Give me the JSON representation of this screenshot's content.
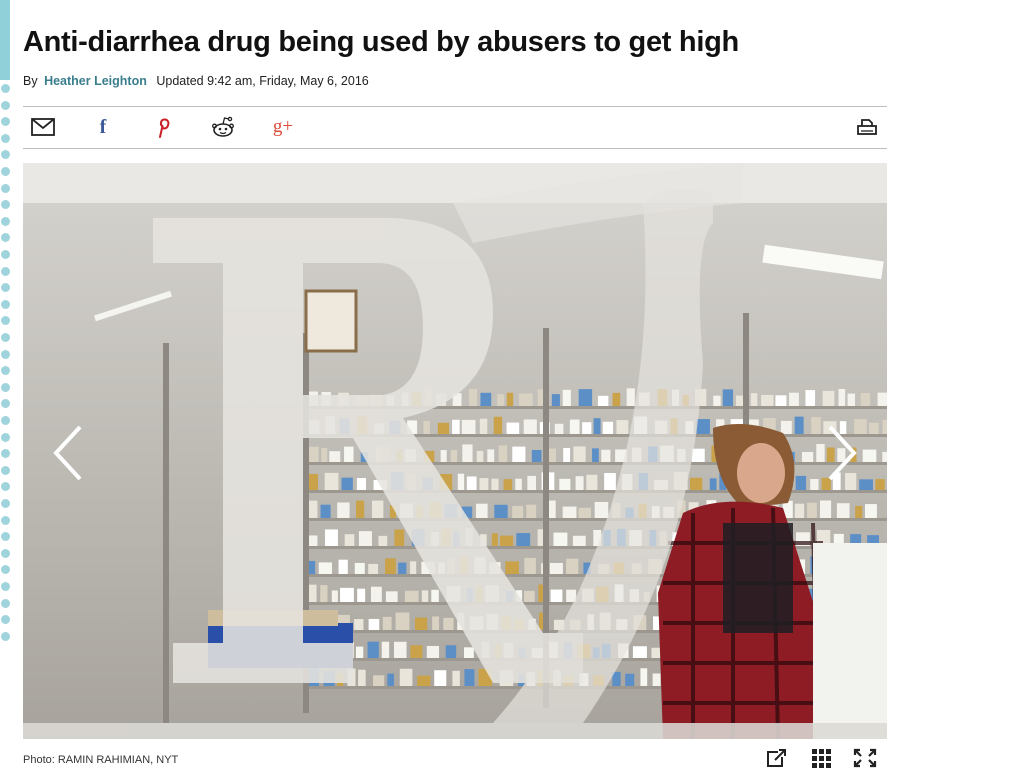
{
  "article": {
    "headline": "Anti-diarrhea drug being used by abusers to get high",
    "byline_prefix": "By",
    "author": "Heather Leighton",
    "updated": "Updated 9:42 am, Friday, May 6, 2016"
  },
  "share_bar": {
    "icons": [
      "email-icon",
      "facebook-icon",
      "pinterest-icon",
      "reddit-icon",
      "google-plus-icon",
      "print-icon"
    ],
    "facebook_glyph": "f",
    "google_plus_glyph": "g+",
    "accent_colors": {
      "facebook": "#3b5998",
      "pinterest": "#cb2027",
      "google_plus": "#dd4b39"
    }
  },
  "gallery": {
    "caption": "Photo: RAMIN RAHIMIAN, NYT",
    "tools": [
      "open-external-icon",
      "grid-icon",
      "fullscreen-icon"
    ]
  },
  "colors": {
    "author": "#3a7d8c",
    "accent_bar": "#8fd0d9"
  }
}
